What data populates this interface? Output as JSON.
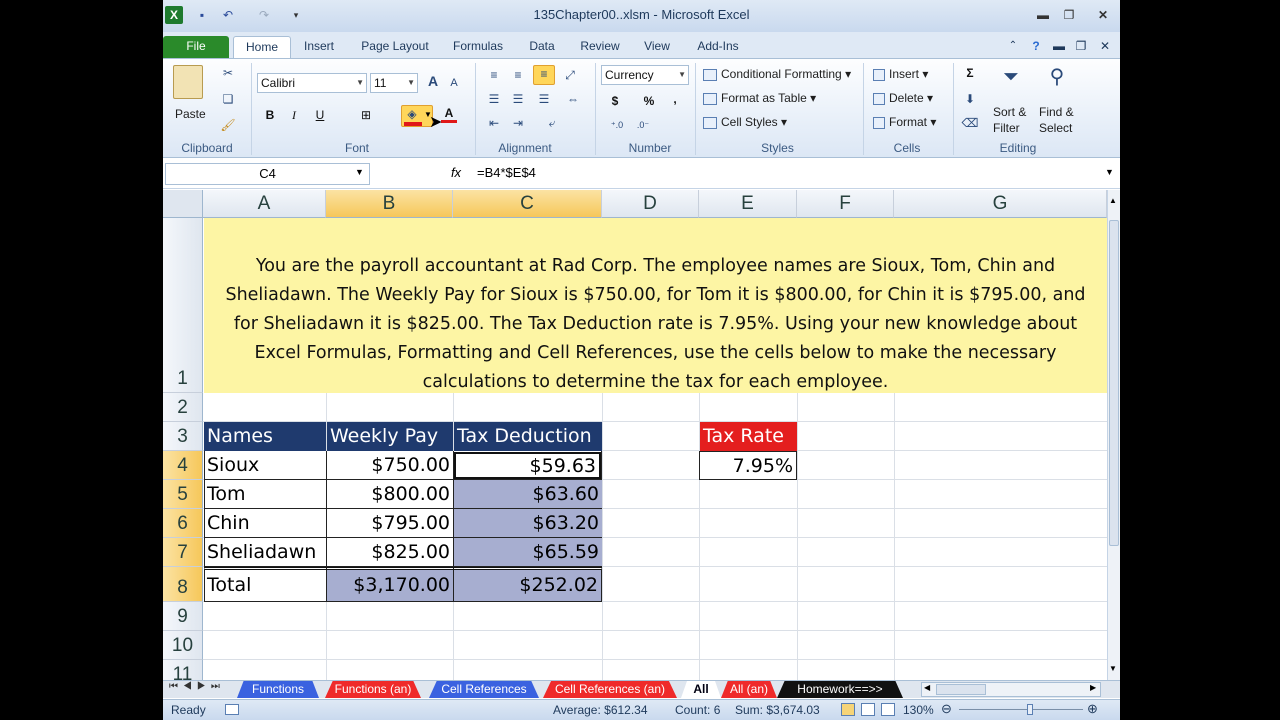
{
  "window": {
    "title": "135Chapter00..xlsm  -  Microsoft Excel"
  },
  "tabs": [
    "File",
    "Home",
    "Insert",
    "Page Layout",
    "Formulas",
    "Data",
    "Review",
    "View",
    "Add-Ins"
  ],
  "ribbon": {
    "clipboard": {
      "paste": "Paste",
      "label": "Clipboard"
    },
    "font": {
      "name": "Calibri",
      "size": "11",
      "bold": "B",
      "italic": "I",
      "underline": "U",
      "grow": "A",
      "shrink": "A",
      "fontcolor": "A",
      "label": "Font"
    },
    "alignment": {
      "label": "Alignment"
    },
    "number": {
      "format": "Currency",
      "dollar": "$",
      "percent": "%",
      "comma": ",",
      "label": "Number"
    },
    "styles": {
      "conditional": "Conditional Formatting",
      "format_table": "Format as Table",
      "cell_styles": "Cell Styles",
      "label": "Styles"
    },
    "cells": {
      "insert": "Insert",
      "delete": "Delete",
      "format": "Format",
      "label": "Cells"
    },
    "editing": {
      "sigma": "Σ",
      "sort1": "Sort &",
      "sort2": "Filter",
      "find1": "Find &",
      "find2": "Select",
      "label": "Editing"
    }
  },
  "formula_bar": {
    "name_box": "C4",
    "fx": "fx",
    "formula": "=B4*$E$4"
  },
  "columns": [
    "A",
    "B",
    "C",
    "D",
    "E",
    "F",
    "G"
  ],
  "rows": [
    "1",
    "2",
    "3",
    "4",
    "5",
    "6",
    "7",
    "8",
    "9",
    "10",
    "11"
  ],
  "banner_lines": [
    "You are the payroll accountant at Rad Corp. The employee names are Sioux, Tom, Chin and",
    "Sheliadawn. The Weekly Pay for Sioux is $750.00, for Tom it is $800.00, for Chin it is $795.00, and",
    "for Sheliadawn it is $825.00. The Tax Deduction rate is 7.95%. Using your new knowledge about",
    "Excel Formulas, Formatting and Cell References, use the cells below to make the necessary",
    "calculations to determine the tax for each employee."
  ],
  "table": {
    "headers": [
      "Names",
      "Weekly Pay",
      "Tax Deduction"
    ],
    "rows": [
      [
        "Sioux",
        "$750.00",
        "$59.63"
      ],
      [
        "Tom",
        "$800.00",
        "$63.60"
      ],
      [
        "Chin",
        "$795.00",
        "$63.20"
      ],
      [
        "Sheliadawn",
        "$825.00",
        "$65.59"
      ]
    ],
    "total": [
      "Total",
      "$3,170.00",
      "$252.02"
    ]
  },
  "tax": {
    "label": "Tax Rate",
    "value": "7.95%"
  },
  "sheet_tabs": [
    "Functions",
    "Functions (an)",
    "Cell References",
    "Cell References (an)",
    "All",
    "All (an)",
    "Homework==>>"
  ],
  "status": {
    "ready": "Ready",
    "average": "Average: $612.34",
    "count": "Count: 6",
    "sum": "Sum: $3,674.03",
    "zoom": "130%"
  }
}
